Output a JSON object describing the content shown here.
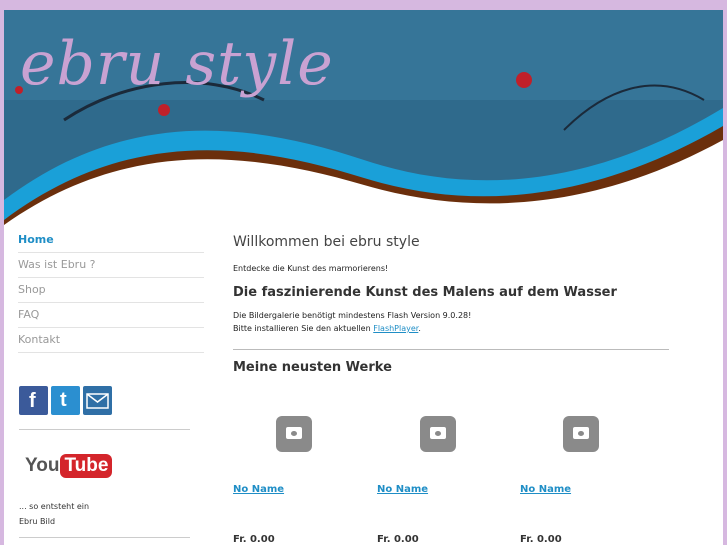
{
  "header": {
    "logo_text": "ebru style"
  },
  "nav": {
    "items": [
      {
        "label": "Home",
        "active": true
      },
      {
        "label": "Was ist Ebru ?",
        "active": false
      },
      {
        "label": "Shop",
        "active": false
      },
      {
        "label": "FAQ",
        "active": false
      },
      {
        "label": "Kontakt",
        "active": false
      }
    ]
  },
  "social": {
    "icons": [
      "facebook-icon",
      "twitter-icon",
      "email-icon"
    ]
  },
  "youtube": {
    "logo_you": "You",
    "logo_tube": "Tube",
    "caption_line1": "... so entsteht ein",
    "caption_line2": "Ebru Bild"
  },
  "main": {
    "title": "Willkommen bei ebru style",
    "intro": "Entdecke die Kunst des marmorierens!",
    "subtitle": "Die faszinierende Kunst des Malens auf dem Wasser",
    "flash_line1": "Die Bildergalerie benötigt mindestens Flash Version 9.0.28!",
    "flash_line2_prefix": "Bitte installieren Sie den aktuellen ",
    "flash_link": "FlashPlayer",
    "flash_line2_suffix": ".",
    "works_title": "Meine neusten Werke",
    "products": [
      {
        "name": "No Name",
        "price": "Fr. 0.00"
      },
      {
        "name": "No Name",
        "price": "Fr. 0.00"
      },
      {
        "name": "No Name",
        "price": "Fr. 0.00"
      }
    ]
  },
  "colors": {
    "accent": "#1f8ec6",
    "background": "#d6b8e0",
    "header_blue": "#2f6a8c",
    "brown": "#6b2f0c",
    "cyan_wave": "#1aa0d8",
    "logo": "#c9a2d2"
  }
}
